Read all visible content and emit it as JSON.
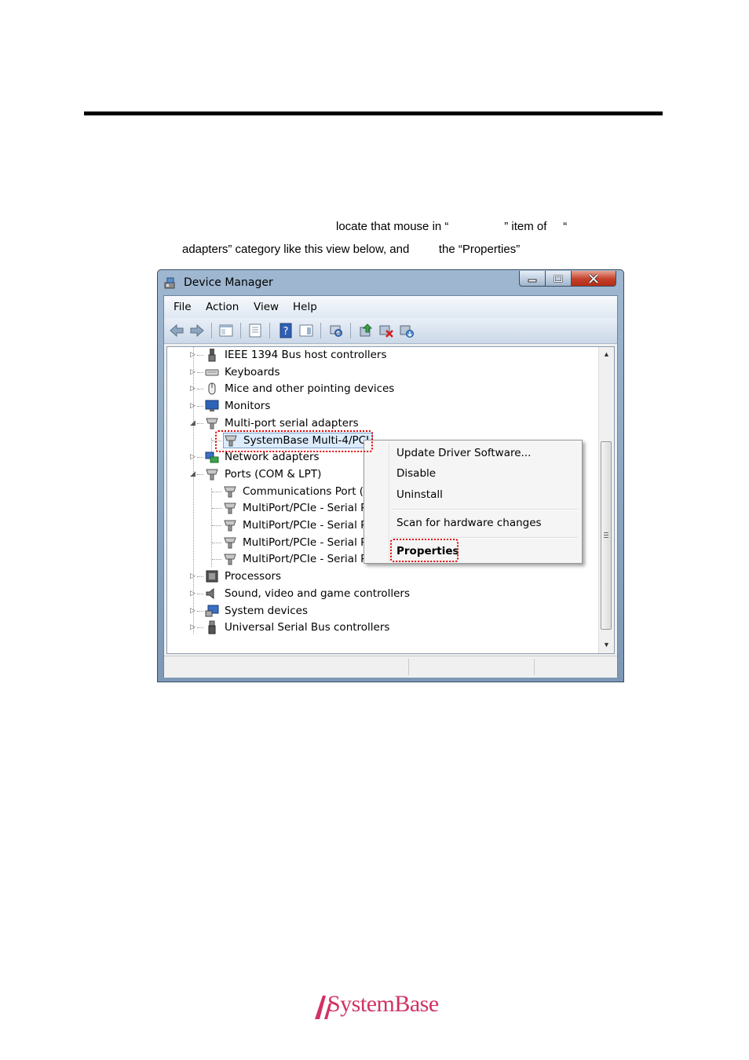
{
  "doc": {
    "line1": "locate that mouse in “                 ” item of     “",
    "line2": "adapters” category like this view below, and         the “Properties”"
  },
  "window": {
    "title": "Device Manager",
    "menu": [
      "File",
      "Action",
      "View",
      "Help"
    ]
  },
  "tree": {
    "items": [
      {
        "label": "IEEE 1394 Bus host controllers",
        "icon": "ieee1394-icon",
        "level": 0,
        "expander": "collapsed"
      },
      {
        "label": "Keyboards",
        "icon": "keyboard-icon",
        "level": 0,
        "expander": "collapsed"
      },
      {
        "label": "Mice and other pointing devices",
        "icon": "mouse-icon",
        "level": 0,
        "expander": "collapsed"
      },
      {
        "label": "Monitors",
        "icon": "monitor-icon",
        "level": 0,
        "expander": "collapsed"
      },
      {
        "label": "Multi-port serial adapters",
        "icon": "serial-port-icon",
        "level": 0,
        "expander": "expanded"
      },
      {
        "label": "SystemBase Multi-4/PCI",
        "icon": "serial-port-icon",
        "level": 1,
        "expander": "none",
        "selected": true
      },
      {
        "label": "Network adapters",
        "icon": "network-icon",
        "level": 0,
        "expander": "collapsed"
      },
      {
        "label": "Ports (COM & LPT)",
        "icon": "serial-port-icon",
        "level": 0,
        "expander": "expanded"
      },
      {
        "label": "Communications Port (C",
        "icon": "serial-port-icon",
        "level": 1,
        "expander": "none"
      },
      {
        "label": "MultiPort/PCIe - Serial P",
        "icon": "serial-port-icon",
        "level": 1,
        "expander": "none"
      },
      {
        "label": "MultiPort/PCIe - Serial P",
        "icon": "serial-port-icon",
        "level": 1,
        "expander": "none"
      },
      {
        "label": "MultiPort/PCIe - Serial P",
        "icon": "serial-port-icon",
        "level": 1,
        "expander": "none"
      },
      {
        "label": "MultiPort/PCIe - Serial P",
        "icon": "serial-port-icon",
        "level": 1,
        "expander": "none"
      },
      {
        "label": "Processors",
        "icon": "processor-icon",
        "level": 0,
        "expander": "collapsed"
      },
      {
        "label": "Sound, video and game controllers",
        "icon": "speaker-icon",
        "level": 0,
        "expander": "collapsed"
      },
      {
        "label": "System devices",
        "icon": "system-devices-icon",
        "level": 0,
        "expander": "collapsed"
      },
      {
        "label": "Universal Serial Bus controllers",
        "icon": "usb-icon",
        "level": 0,
        "expander": "collapsed"
      }
    ]
  },
  "context_menu": {
    "items": [
      "Update Driver Software...",
      "Disable",
      "Uninstall",
      "Scan for hardware changes",
      "Properties"
    ]
  },
  "logo": {
    "text": "SystemBase",
    "color": "#d23263"
  },
  "colors": {
    "highlight": "#e00000",
    "title_bar": "#8aa6c4"
  }
}
